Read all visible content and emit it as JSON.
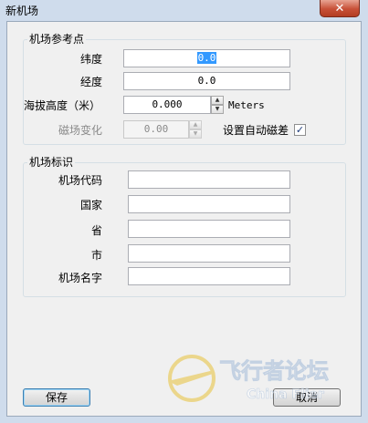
{
  "window": {
    "title": "新机场",
    "close_glyph": "✕"
  },
  "reference": {
    "group_title": "机场参考点",
    "latitude_label": "纬度",
    "latitude_value": "0.0",
    "longitude_label": "经度",
    "longitude_value": "0.0",
    "altitude_label": "海拔高度（米）",
    "altitude_value": "0.000",
    "altitude_unit": "Meters",
    "magvar_label": "磁场变化",
    "magvar_value": "0.00",
    "auto_magvar_label": "设置自动磁差",
    "auto_magvar_checked": "✓"
  },
  "ident": {
    "group_title": "机场标识",
    "code_label": "机场代码",
    "code_value": "",
    "country_label": "国家",
    "country_value": "",
    "province_label": "省",
    "province_value": "",
    "city_label": "市",
    "city_value": "",
    "name_label": "机场名字",
    "name_value": ""
  },
  "buttons": {
    "save_label": "保存",
    "cancel_label": "取消"
  },
  "watermark": {
    "text": "飞行者论坛",
    "subtext": "China Flier"
  },
  "icons": {
    "spin_up": "spin-up-icon",
    "spin_down": "spin-down-icon",
    "close": "close-icon"
  },
  "colors": {
    "accent_selection": "#3399ff",
    "check": "#1e3a78",
    "close_button": "#c75037"
  }
}
